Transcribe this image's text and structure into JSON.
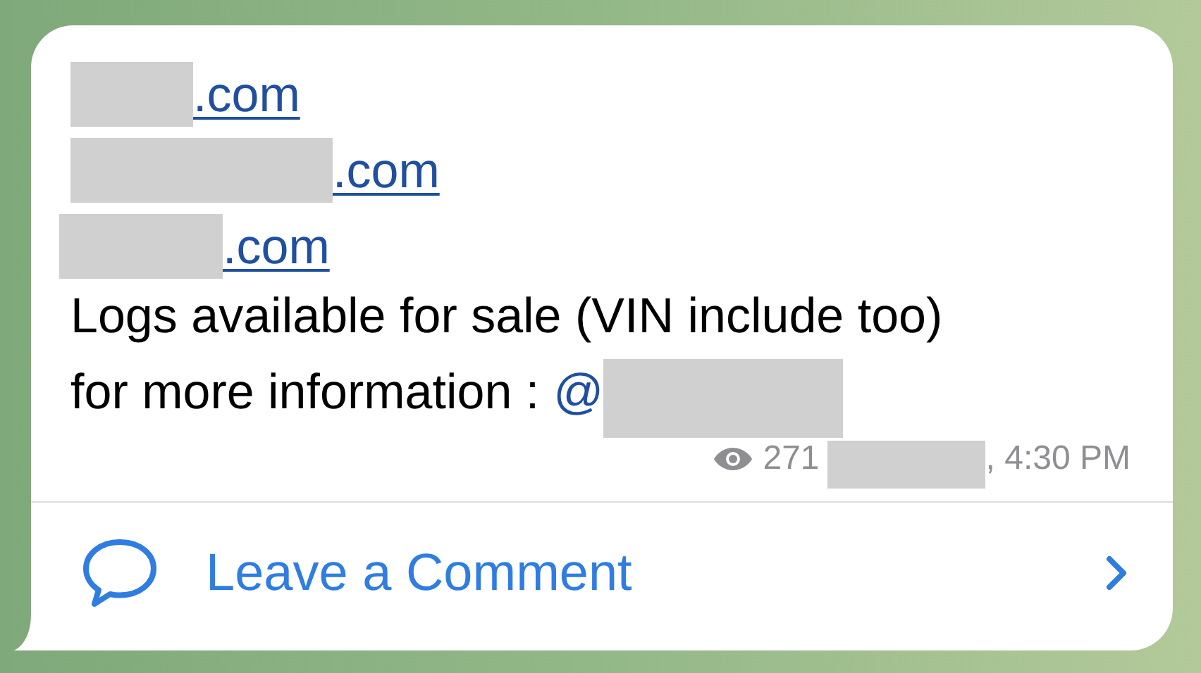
{
  "message": {
    "links": [
      {
        "text": ".com"
      },
      {
        "text": ".com"
      },
      {
        "text": ".com"
      }
    ],
    "body": "Logs available for sale (VIN include too)",
    "info": "for more information :",
    "mention": "@",
    "views": "271",
    "time": ", 4:30 PM"
  },
  "comment_button": {
    "label": "Leave a Comment"
  }
}
